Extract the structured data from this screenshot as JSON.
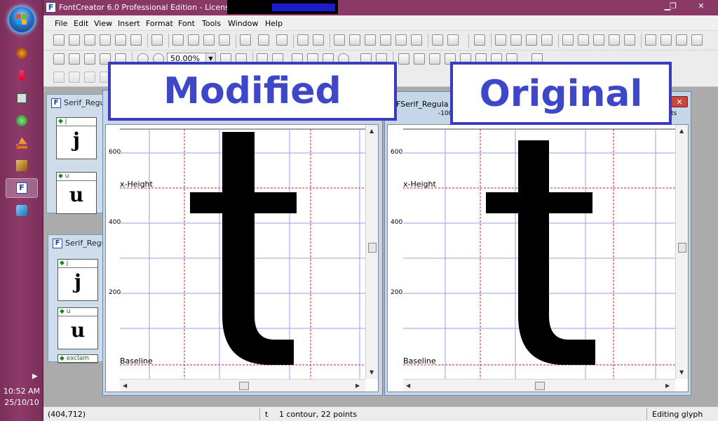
{
  "clock": {
    "time": "10:52 AM",
    "date": "25/10/10"
  },
  "app": {
    "title": "FontCreator 6.0 Professional Edition - Licensed to",
    "icon_letter": "F"
  },
  "window_controls": {
    "minimize": "▁",
    "restore": "❐",
    "close": "✕"
  },
  "menu": [
    "File",
    "Edit",
    "View",
    "Insert",
    "Format",
    "Font",
    "Tools",
    "Window",
    "Help"
  ],
  "toolbar": {
    "zoom": "50.00%"
  },
  "overview_windows": [
    {
      "title": "Serif_Regu",
      "cells": [
        {
          "label": "j",
          "glyph": "j"
        },
        {
          "label": "u",
          "glyph": "u"
        }
      ]
    },
    {
      "title": "Serif_Regu",
      "cells": [
        {
          "label": "j",
          "glyph": "j"
        },
        {
          "label": "u",
          "glyph": "u"
        },
        {
          "label": "exclam",
          "glyph": ""
        }
      ]
    }
  ],
  "editor_left": {
    "ruler": [
      "600",
      "400",
      "200"
    ],
    "x_height_label": "x-Height",
    "baseline_label": "Baseline"
  },
  "editor_right": {
    "title": "Serif_Regula",
    "ruler_top": "-100",
    "ruler_top_right": "ts",
    "ruler": [
      "600",
      "400",
      "200"
    ],
    "x_height_label": "x-Height",
    "baseline_label": "Baseline"
  },
  "overlays": {
    "modified": "Modified",
    "original": "Original"
  },
  "statusbar": {
    "coords": "(404,712)",
    "glyph": "t",
    "info": "1 contour, 22 points",
    "mode": "Editing glyph"
  },
  "colors": {
    "overlay_border": "#3b3bbf",
    "overlay_text": "#3d47c8",
    "taskbar": "#8a3966",
    "metric_line": "#c0252a",
    "grid_line": "#9c9ce0"
  }
}
